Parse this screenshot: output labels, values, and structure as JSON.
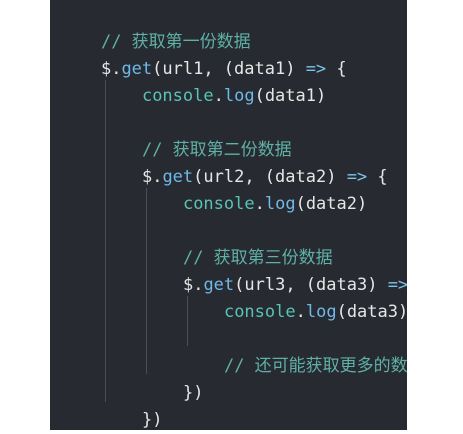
{
  "code": {
    "lines": [
      {
        "comment": "// 获取第一份数据"
      },
      {
        "prefix": "$.",
        "fn": "get",
        "open": "(url1, (data1) ",
        "arrow": "=>",
        "close": " {"
      },
      {
        "obj": "console",
        "dot": ".",
        "fn": "log",
        "args": "(data1)"
      },
      {
        "comment": "// 获取第二份数据"
      },
      {
        "prefix": "$.",
        "fn": "get",
        "open": "(url2, (data2) ",
        "arrow": "=>",
        "close": " {"
      },
      {
        "obj": "console",
        "dot": ".",
        "fn": "log",
        "args": "(data2)"
      },
      {
        "comment": "// 获取第三份数据"
      },
      {
        "prefix": "$.",
        "fn": "get",
        "open": "(url3, (data3) ",
        "arrow": "=>",
        "close": " {"
      },
      {
        "obj": "console",
        "dot": ".",
        "fn": "log",
        "args": "(data3)"
      },
      {
        "comment": "// 还可能获取更多的数据"
      },
      {
        "text": "})"
      },
      {
        "text": "})"
      },
      {
        "text": "})"
      }
    ]
  }
}
